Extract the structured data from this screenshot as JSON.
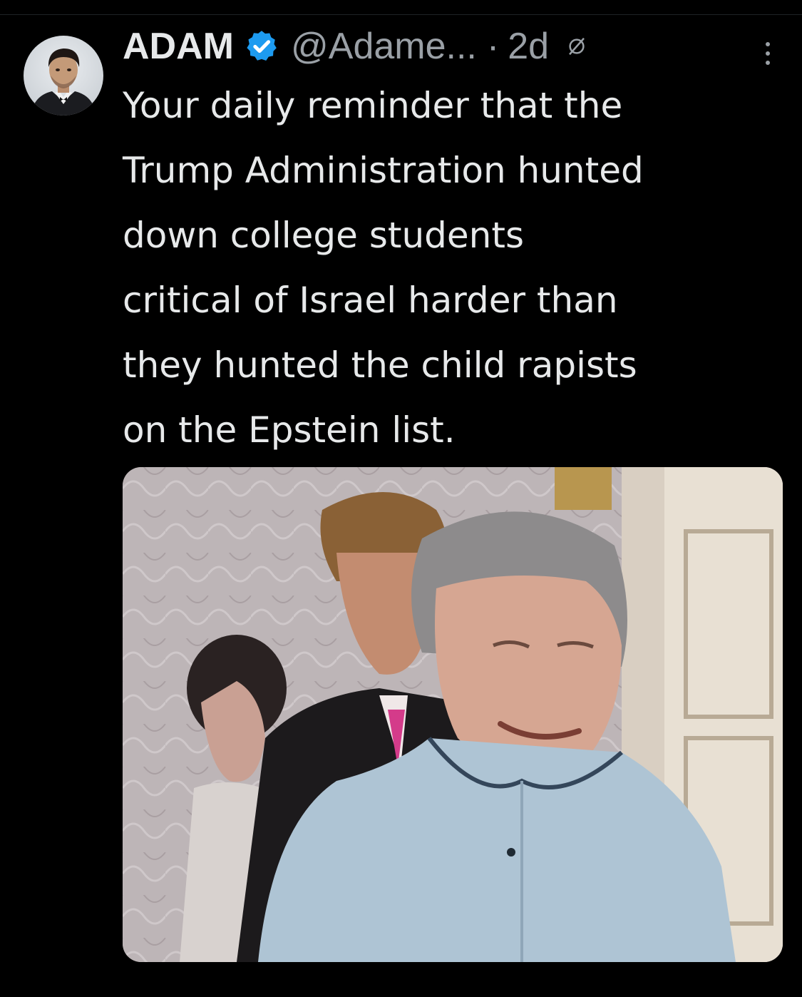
{
  "post": {
    "author_name": "ADAM",
    "handle": "@Adame...",
    "separator": "·",
    "time": "2d",
    "text": "Your daily reminder that the\nTrump Administration hunted\ndown college students\ncritical of Israel harder than\nthey hunted the child rapists\non the Epstein list.",
    "icons": {
      "avatar": "profile-photo",
      "verified": "verified-badge-icon",
      "edited": "edited-icon",
      "more": "more-vertical-icon"
    },
    "media": {
      "kind": "photo"
    }
  },
  "colors": {
    "background": "#000000",
    "text_primary": "#e7e9ea",
    "text_secondary": "#9aa0a6",
    "verified_blue": "#1d9bf0"
  }
}
